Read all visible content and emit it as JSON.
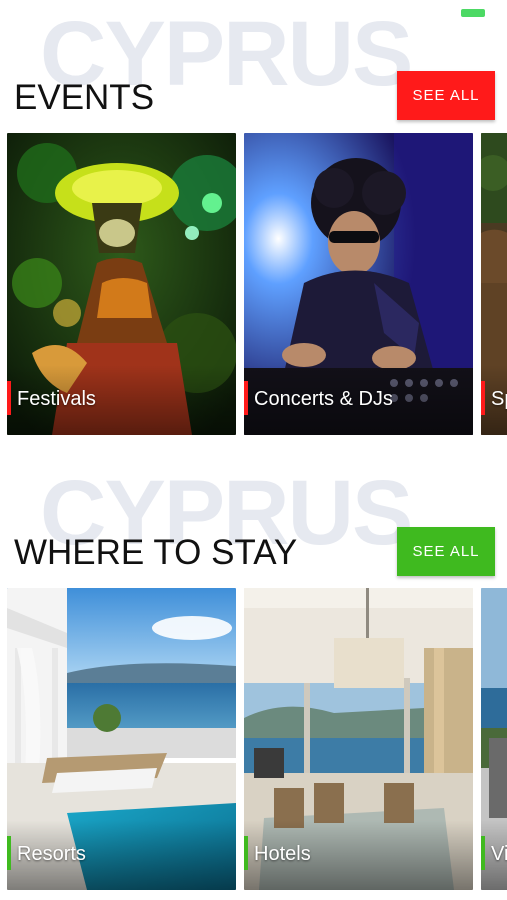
{
  "colors": {
    "events_accent": "#ff1a1a",
    "stay_accent": "#3fba1f",
    "watermark": "#e6e9f0",
    "status_indicator": "#4cd964"
  },
  "sections": {
    "events": {
      "watermark": "CYPRUS",
      "title": "EVENTS",
      "see_all_label": "SEE ALL",
      "cards": [
        {
          "label": "Festivals",
          "image": "masked-festival-dancer"
        },
        {
          "label": "Concerts & DJs",
          "image": "dj-at-mixer"
        },
        {
          "label": "Sp",
          "image": "partial-outdoor-scene"
        }
      ]
    },
    "stay": {
      "watermark": "CYPRUS",
      "title": "WHERE TO STAY",
      "see_all_label": "SEE ALL",
      "cards": [
        {
          "label": "Resorts",
          "image": "seaside-pool-terrace"
        },
        {
          "label": "Hotels",
          "image": "hotel-dining-room-sea-view"
        },
        {
          "label": "Vi",
          "image": "partial-villa-view"
        }
      ]
    }
  }
}
